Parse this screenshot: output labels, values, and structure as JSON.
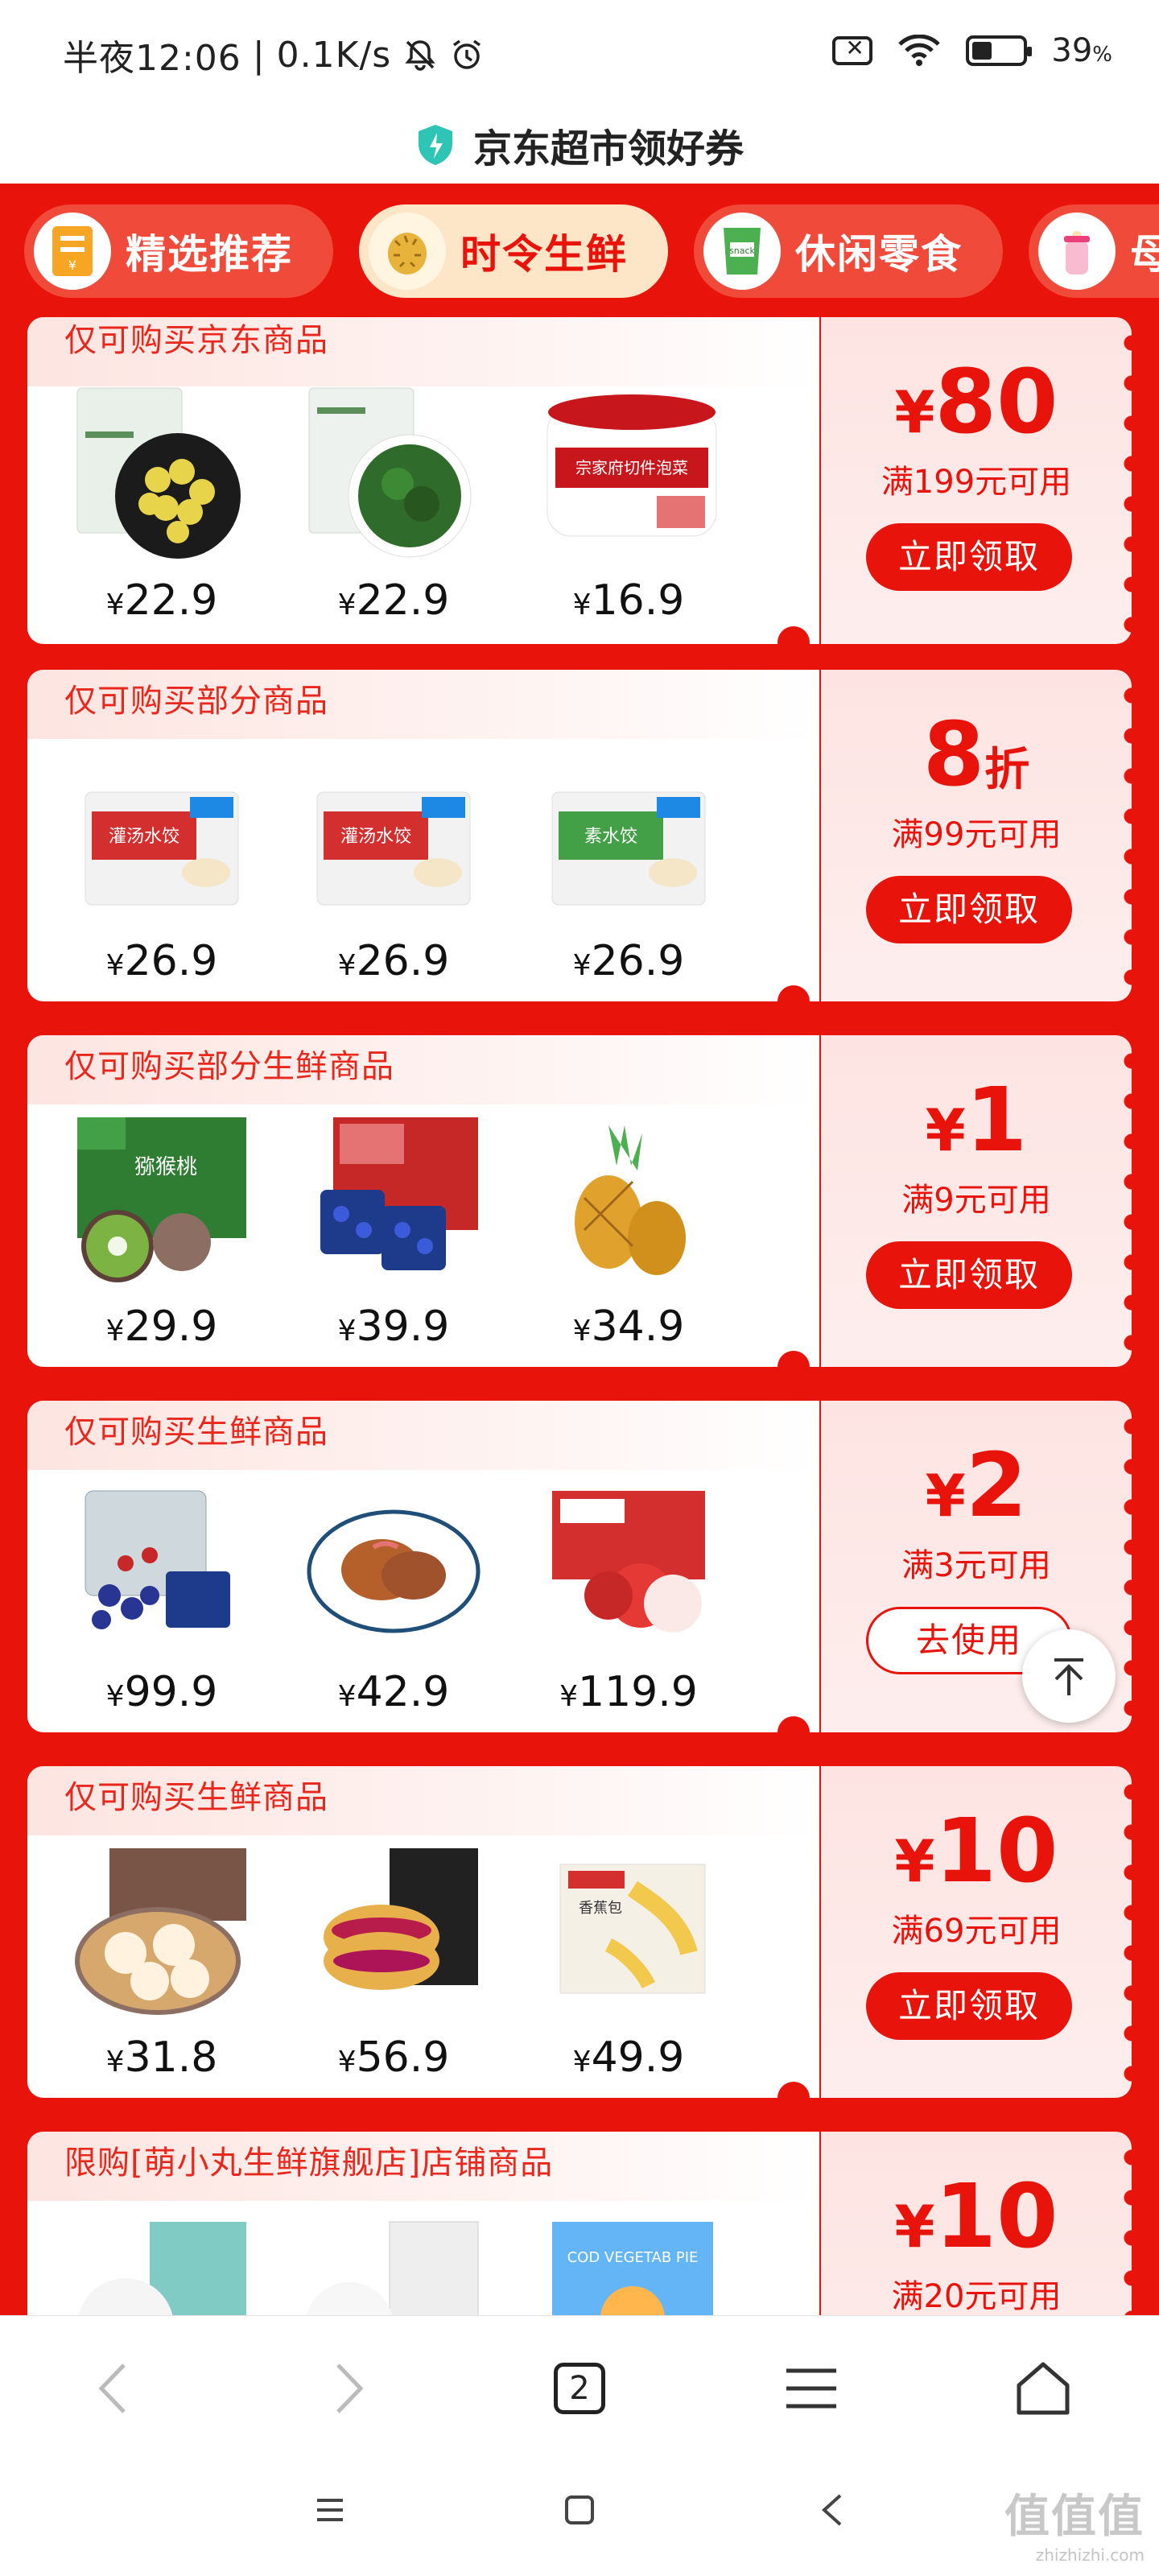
{
  "status_bar": {
    "time": "半夜12:06",
    "network_speed": "0.1K/s",
    "battery": "39"
  },
  "header": {
    "title": "京东超市领好券"
  },
  "tabs": [
    {
      "label": "精选推荐",
      "active": false
    },
    {
      "label": "时令生鲜",
      "active": true
    },
    {
      "label": "休闲零食",
      "active": false
    },
    {
      "label": "母",
      "active": false
    }
  ],
  "coupons": [
    {
      "restriction": "仅可购买京东商品",
      "currency": "¥",
      "amount": "80",
      "unit": "",
      "condition": "满199元可用",
      "button": "立即领取",
      "products": [
        {
          "yen": "¥",
          "price": "22.9"
        },
        {
          "yen": "¥",
          "price": "22.9"
        },
        {
          "yen": "¥",
          "price": "16.9",
          "label": "宗家府切件泡菜"
        }
      ]
    },
    {
      "restriction": "仅可购买部分商品",
      "currency": "",
      "amount": "8",
      "unit": "折",
      "condition": "满99元可用",
      "button": "立即领取",
      "products": [
        {
          "yen": "¥",
          "price": "26.9",
          "label": "灌汤水饺"
        },
        {
          "yen": "¥",
          "price": "26.9",
          "label": "灌汤水饺"
        },
        {
          "yen": "¥",
          "price": "26.9",
          "label": "素水饺"
        }
      ]
    },
    {
      "restriction": "仅可购买部分生鲜商品",
      "currency": "¥",
      "amount": "1",
      "unit": "",
      "condition": "满9元可用",
      "button": "立即领取",
      "products": [
        {
          "yen": "¥",
          "price": "29.9",
          "label": "猕猴桃"
        },
        {
          "yen": "¥",
          "price": "39.9"
        },
        {
          "yen": "¥",
          "price": "34.9"
        }
      ]
    },
    {
      "restriction": "仅可购买生鲜商品",
      "currency": "¥",
      "amount": "2",
      "unit": "",
      "condition": "满3元可用",
      "button": "去使用",
      "products": [
        {
          "yen": "¥",
          "price": "99.9"
        },
        {
          "yen": "¥",
          "price": "42.9"
        },
        {
          "yen": "¥",
          "price": "119.9"
        }
      ]
    },
    {
      "restriction": "仅可购买生鲜商品",
      "currency": "¥",
      "amount": "10",
      "unit": "",
      "condition": "满69元可用",
      "button": "立即领取",
      "products": [
        {
          "yen": "¥",
          "price": "31.8"
        },
        {
          "yen": "¥",
          "price": "56.9"
        },
        {
          "yen": "¥",
          "price": "49.9",
          "label": "香蕉包"
        }
      ]
    },
    {
      "restriction": "限购[萌小丸生鲜旗舰店]店铺商品",
      "currency": "¥",
      "amount": "10",
      "unit": "",
      "condition": "满20元可用",
      "button": "",
      "products": [
        {
          "yen": "",
          "price": ""
        },
        {
          "yen": "",
          "price": ""
        },
        {
          "yen": "",
          "price": "",
          "label": "COD VEGETAB PIE"
        }
      ]
    }
  ],
  "browser_nav": {
    "tab_count": "2"
  },
  "watermark": {
    "text": "值值值",
    "url": "zhizhizhi.com"
  },
  "colors": {
    "brand_red": "#e8140c",
    "active_tab_bg": "#fde6c8"
  }
}
